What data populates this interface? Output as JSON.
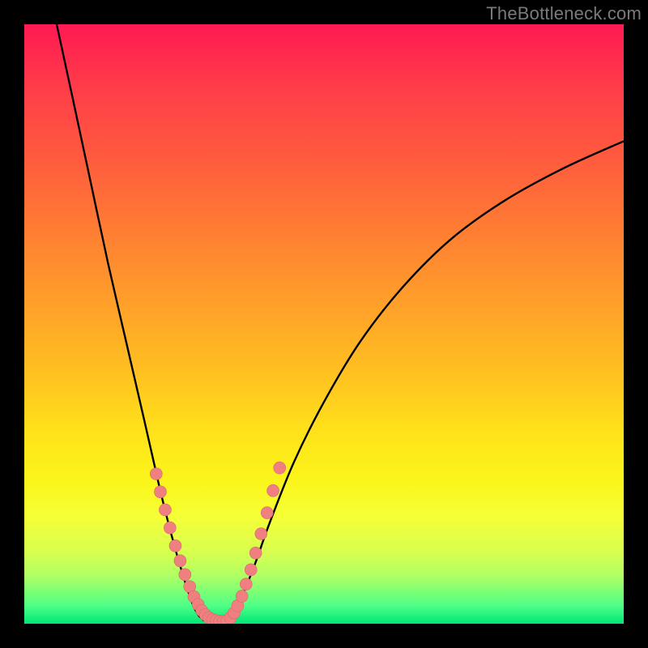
{
  "watermark": "TheBottleneck.com",
  "colors": {
    "page_bg": "#000000",
    "curve": "#000000",
    "dot_fill": "#f08080",
    "dot_stroke": "#d46a6a"
  },
  "chart_data": {
    "type": "line",
    "title": "",
    "xlabel": "",
    "ylabel": "",
    "xlim": [
      0,
      100
    ],
    "ylim": [
      0,
      100
    ],
    "grid": false,
    "legend": null,
    "note": "Axes have no visible tick labels; x/y are normalized 0–100 estimated from pixel positions (origin bottom-left).",
    "series": [
      {
        "name": "left-branch",
        "kind": "curve",
        "x": [
          5.4,
          8.0,
          11.0,
          14.0,
          17.0,
          20.0,
          22.5,
          24.5,
          26.5,
          28.0,
          29.0,
          30.0
        ],
        "y": [
          100.0,
          88.0,
          74.0,
          60.0,
          47.0,
          34.0,
          23.0,
          15.0,
          8.0,
          3.5,
          1.5,
          0.5
        ]
      },
      {
        "name": "right-branch",
        "kind": "curve",
        "x": [
          34.0,
          35.0,
          36.5,
          38.5,
          41.0,
          45.0,
          50.0,
          56.0,
          63.0,
          71.0,
          80.0,
          90.0,
          100.0
        ],
        "y": [
          0.5,
          2.0,
          5.0,
          10.0,
          17.0,
          27.0,
          37.0,
          47.0,
          56.0,
          64.0,
          70.5,
          76.0,
          80.5
        ]
      },
      {
        "name": "dots-left",
        "kind": "scatter",
        "x": [
          22.0,
          22.7,
          23.5,
          24.3,
          25.2,
          26.0,
          26.8,
          27.6,
          28.3,
          29.0,
          29.6,
          30.2,
          30.8,
          31.4,
          32.0,
          32.6,
          33.2
        ],
        "y": [
          25.0,
          22.0,
          19.0,
          16.0,
          13.0,
          10.5,
          8.2,
          6.2,
          4.5,
          3.2,
          2.2,
          1.5,
          1.0,
          0.7,
          0.5,
          0.4,
          0.4
        ]
      },
      {
        "name": "dots-right",
        "kind": "scatter",
        "x": [
          33.8,
          34.4,
          35.0,
          35.6,
          36.3,
          37.0,
          37.8,
          38.6,
          39.5,
          40.5,
          41.5,
          42.6
        ],
        "y": [
          0.5,
          1.0,
          1.8,
          3.0,
          4.6,
          6.6,
          9.0,
          11.8,
          15.0,
          18.5,
          22.2,
          26.0
        ]
      }
    ]
  }
}
